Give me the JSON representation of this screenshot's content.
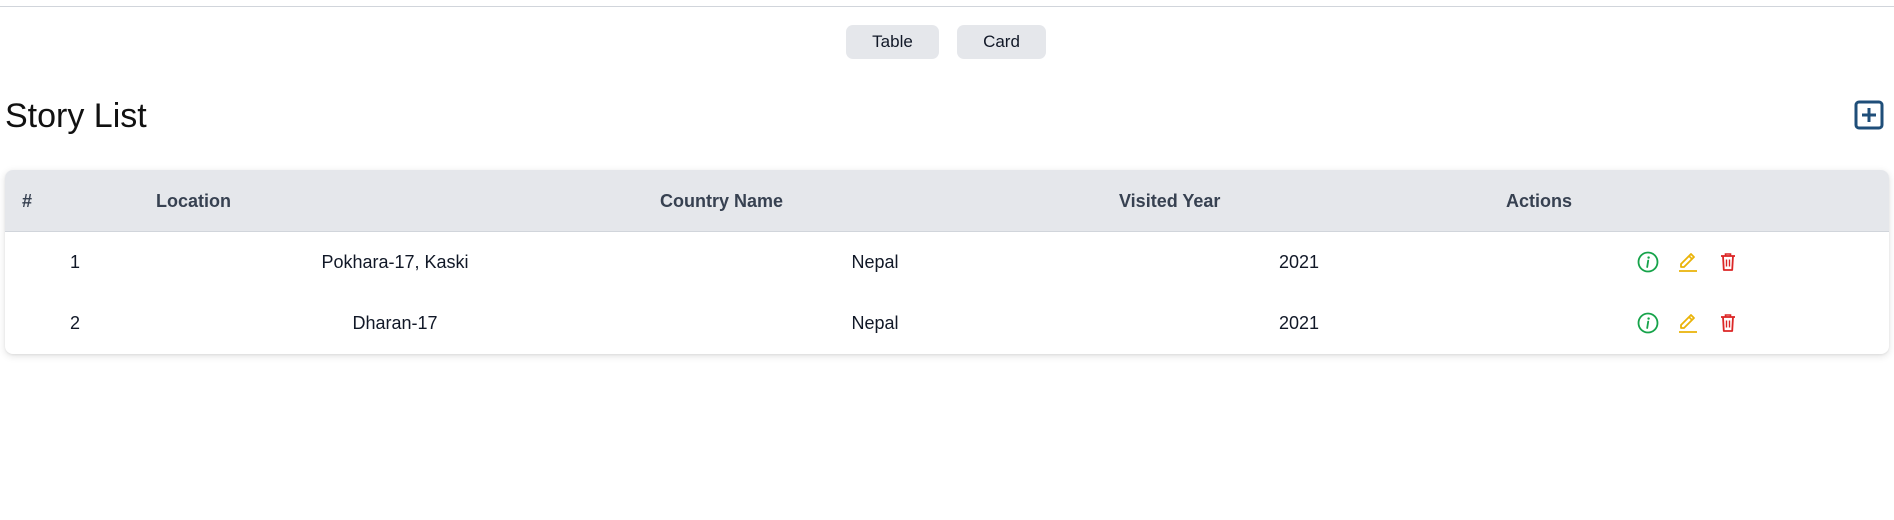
{
  "view_toggle": {
    "table_label": "Table",
    "card_label": "Card"
  },
  "page": {
    "title": "Story List"
  },
  "table": {
    "columns": [
      "#",
      "Location",
      "Country Name",
      "Visited Year",
      "Actions"
    ],
    "rows": [
      {
        "index": "1",
        "location": "Pokhara-17, Kaski",
        "country": "Nepal",
        "year": "2021"
      },
      {
        "index": "2",
        "location": "Dharan-17",
        "country": "Nepal",
        "year": "2021"
      }
    ]
  },
  "colors": {
    "header_bg": "#e5e7eb",
    "add_icon": "#1f4e79",
    "info_icon": "#16a34a",
    "edit_icon": "#eab308",
    "delete_icon": "#dc2626"
  },
  "icons": {
    "add": "plus-square-icon",
    "info": "info-circle-icon",
    "edit": "pencil-icon",
    "delete": "trash-icon"
  }
}
